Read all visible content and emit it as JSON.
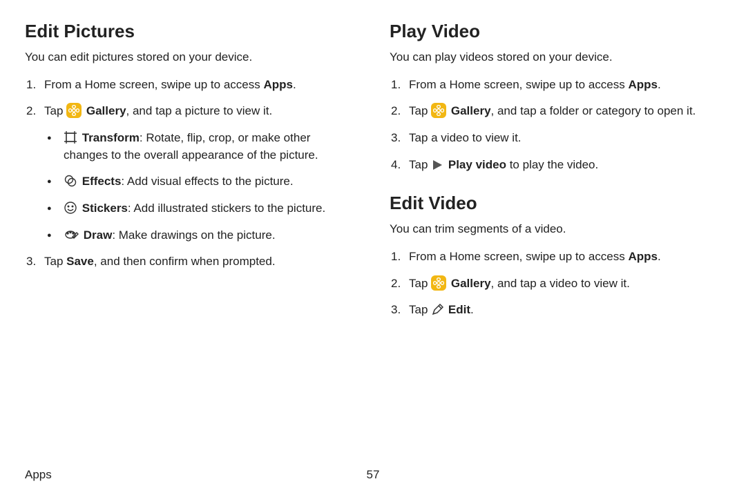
{
  "footer": {
    "section": "Apps",
    "page": "57"
  },
  "left": {
    "heading": "Edit Pictures",
    "intro": "You can edit pictures stored on your device.",
    "step1_a": "From a Home screen, swipe up to access ",
    "step1_b": "Apps",
    "step1_c": ".",
    "step2_a": "Tap ",
    "step2_gallery": "Gallery",
    "step2_b": ", and tap a picture to view it.",
    "bullet_transform_label": "Transform",
    "bullet_transform_text": ": Rotate, flip, crop, or make other changes to the overall appearance of the picture.",
    "bullet_effects_label": "Effects",
    "bullet_effects_text": ": Add visual effects to the picture.",
    "bullet_stickers_label": "Stickers",
    "bullet_stickers_text": ": Add illustrated stickers to the picture.",
    "bullet_draw_label": "Draw",
    "bullet_draw_text": ": Make drawings on the picture.",
    "step3_a": "Tap ",
    "step3_b": "Save",
    "step3_c": ", and then confirm when prompted."
  },
  "right": {
    "play": {
      "heading": "Play Video",
      "intro": "You can play videos stored on your device.",
      "step1_a": "From a Home screen, swipe up to access ",
      "step1_b": "Apps",
      "step1_c": ".",
      "step2_a": "Tap ",
      "step2_gallery": "Gallery",
      "step2_b": ", and tap a folder or category to open it.",
      "step3": "Tap a video to view it.",
      "step4_a": "Tap ",
      "step4_b": "Play video",
      "step4_c": " to play the video."
    },
    "edit": {
      "heading": "Edit Video",
      "intro": "You can trim segments of a video.",
      "step1_a": "From a Home screen, swipe up to access ",
      "step1_b": "Apps",
      "step1_c": ".",
      "step2_a": "Tap ",
      "step2_gallery": "Gallery",
      "step2_b": ", and tap a video to view it.",
      "step3_a": "Tap ",
      "step3_b": "Edit",
      "step3_c": "."
    }
  }
}
